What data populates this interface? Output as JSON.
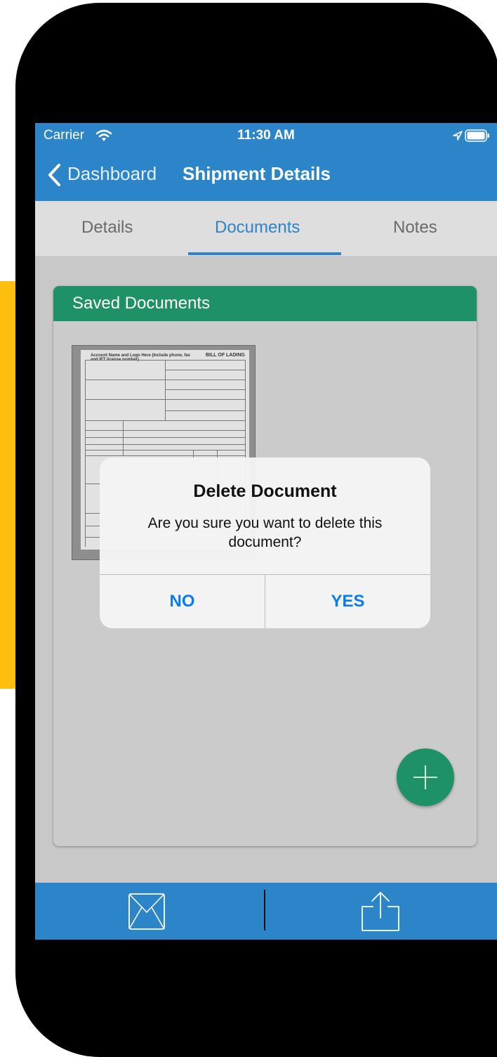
{
  "status_bar": {
    "carrier": "Carrier",
    "time": "11:30 AM",
    "icons": [
      "wifi-icon",
      "location-icon",
      "battery-icon"
    ]
  },
  "nav": {
    "back_label": "Dashboard",
    "title": "Shipment Details"
  },
  "tabs": [
    {
      "label": "Details",
      "selected": false
    },
    {
      "label": "Documents",
      "selected": true
    },
    {
      "label": "Notes",
      "selected": false
    }
  ],
  "card": {
    "title": "Saved Documents",
    "document_thumbnail": {
      "header_left": "Account Name and Logo Here (Include phone, fax and IFT license number)",
      "header_right": "BILL OF LADING"
    }
  },
  "toolbar": {
    "icons": [
      "mail-icon",
      "share-icon"
    ]
  },
  "dialog": {
    "title": "Delete Document",
    "message": "Are you sure you want to delete this document?",
    "no_label": "NO",
    "yes_label": "YES"
  },
  "colors": {
    "primary_blue": "#2c84c9",
    "green": "#1e9266",
    "accent_yellow": "#FDBE10",
    "dialog_button": "#0a7cf0"
  }
}
